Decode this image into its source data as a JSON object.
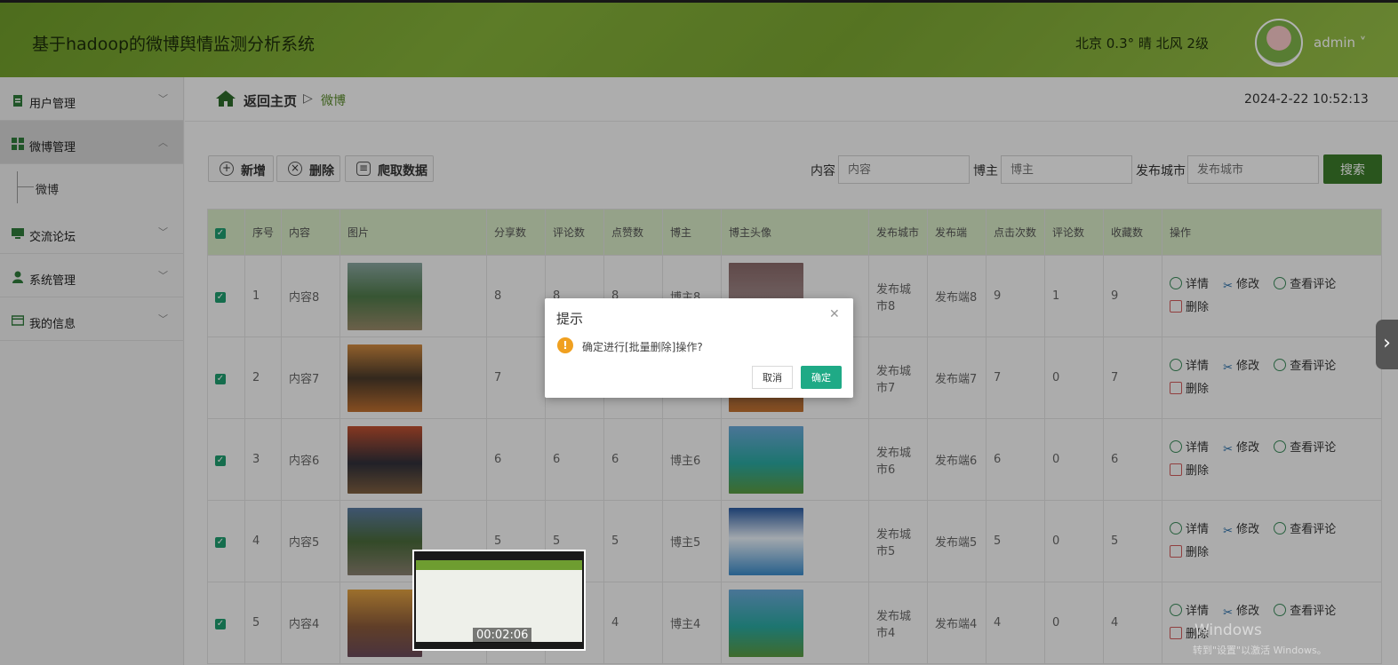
{
  "header": {
    "title": "基于hadoop的微博舆情监测分析系统",
    "weather": "北京  0.3°  晴  北风  2级",
    "username": "admin ˅"
  },
  "sidebar": {
    "items": [
      {
        "label": "用户管理",
        "icon": "clipboard-icon"
      },
      {
        "label": "微博管理",
        "icon": "grid-icon"
      },
      {
        "label": "交流论坛",
        "icon": "monitor-icon"
      },
      {
        "label": "系统管理",
        "icon": "person-icon"
      },
      {
        "label": "我的信息",
        "icon": "card-icon"
      }
    ],
    "sub_item": "微博"
  },
  "breadcrumb": {
    "home": "返回主页",
    "current": "微博",
    "datetime": "2024-2-22 10:52:13"
  },
  "toolbar": {
    "add": "新增",
    "delete": "删除",
    "crawl": "爬取数据"
  },
  "filters": {
    "content_label": "内容",
    "content_placeholder": "内容",
    "blogger_label": "博主",
    "blogger_placeholder": "博主",
    "city_label": "发布城市",
    "city_placeholder": "发布城市",
    "search": "搜索"
  },
  "table": {
    "headers": [
      "序号",
      "内容",
      "图片",
      "分享数",
      "评论数",
      "点赞数",
      "博主",
      "博主头像",
      "发布城市",
      "发布端",
      "点击次数",
      "评论数",
      "收藏数",
      "操作"
    ],
    "rows": [
      {
        "idx": "1",
        "content": "内容8",
        "share": "8",
        "comment": "8",
        "like": "8",
        "blogger": "博主8",
        "city": "发布城市8",
        "client": "发布端8",
        "clicks": "9",
        "comments2": "1",
        "fav": "9"
      },
      {
        "idx": "2",
        "content": "内容7",
        "share": "7",
        "comment": "",
        "like": "",
        "blogger": "",
        "city": "发布城市7",
        "client": "发布端7",
        "clicks": "7",
        "comments2": "0",
        "fav": "7"
      },
      {
        "idx": "3",
        "content": "内容6",
        "share": "6",
        "comment": "6",
        "like": "6",
        "blogger": "博主6",
        "city": "发布城市6",
        "client": "发布端6",
        "clicks": "6",
        "comments2": "0",
        "fav": "6"
      },
      {
        "idx": "4",
        "content": "内容5",
        "share": "5",
        "comment": "5",
        "like": "5",
        "blogger": "博主5",
        "city": "发布城市5",
        "client": "发布端5",
        "clicks": "5",
        "comments2": "0",
        "fav": "5"
      },
      {
        "idx": "5",
        "content": "内容4",
        "share": "",
        "comment": "",
        "like": "4",
        "blogger": "博主4",
        "city": "发布城市4",
        "client": "发布端4",
        "clicks": "4",
        "comments2": "0",
        "fav": "4"
      }
    ],
    "ops": {
      "detail": "详情",
      "edit": "修改",
      "view_comments": "查看评论",
      "delete": "删除"
    }
  },
  "modal": {
    "title": "提示",
    "message": "确定进行[批量删除]操作?",
    "cancel": "取消",
    "ok": "确定"
  },
  "video": {
    "time": "00:02:06"
  },
  "watermark": {
    "line1": "Windows",
    "line2": "转到\"设置\"以激活 Windows。"
  }
}
